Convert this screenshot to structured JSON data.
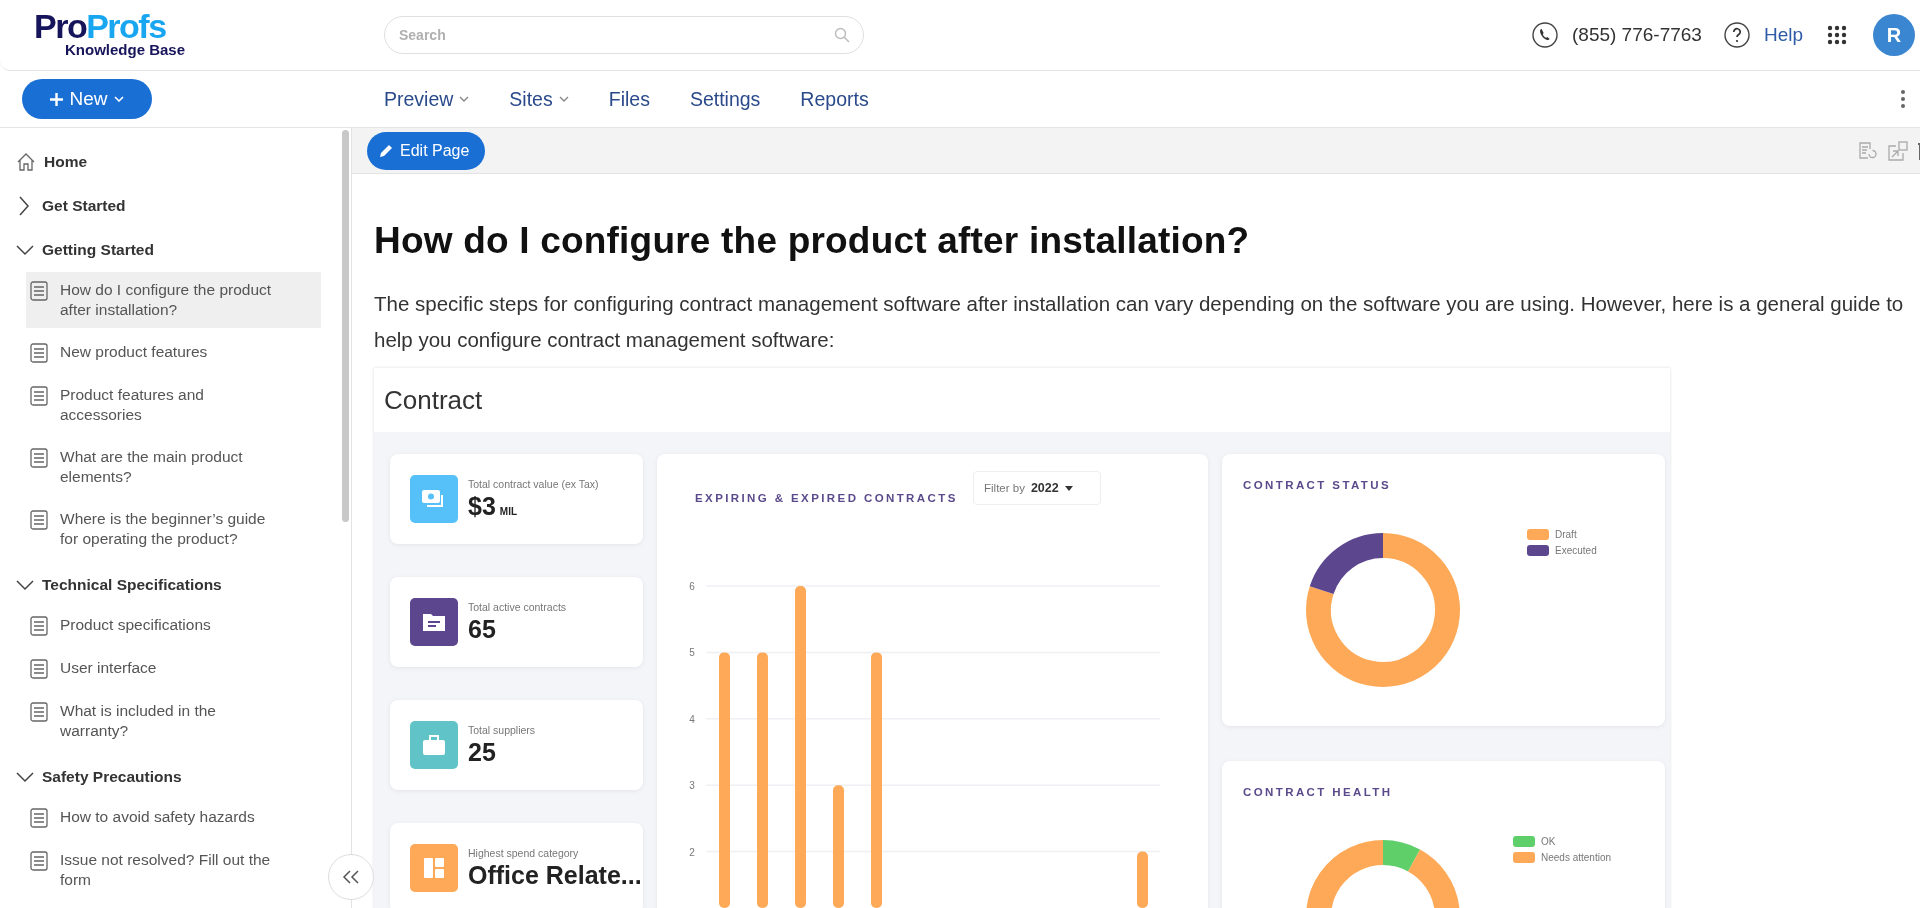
{
  "header": {
    "logo": {
      "wordmark": [
        "Pro",
        "Profs"
      ],
      "subtitle": "Knowledge Base"
    },
    "search": {
      "placeholder": "Search"
    },
    "phone": "(855) 776-7763",
    "help": "Help",
    "avatar": "R"
  },
  "navbar": {
    "new_button": "New",
    "links": [
      {
        "label": "Preview",
        "dropdown": true
      },
      {
        "label": "Sites",
        "dropdown": true
      },
      {
        "label": "Files",
        "dropdown": false
      },
      {
        "label": "Settings",
        "dropdown": false
      },
      {
        "label": "Reports",
        "dropdown": false
      }
    ]
  },
  "toolbar": {
    "edit_button": "Edit Page"
  },
  "sidebar": {
    "items": [
      {
        "label": "Home",
        "kind": "home",
        "selected": false
      },
      {
        "label": "Get Started",
        "kind": "folder",
        "expanded": false,
        "selected": false
      },
      {
        "label": "Getting Started",
        "kind": "folder",
        "expanded": true,
        "selected": false,
        "children": [
          {
            "label": "How do I configure the product after installation?",
            "selected": true
          },
          {
            "label": "New product features",
            "selected": false
          },
          {
            "label": "Product features and accessories",
            "selected": false
          },
          {
            "label": "What are the main product elements?",
            "selected": false
          },
          {
            "label": "Where is the beginner’s guide for operating the product?",
            "selected": false
          }
        ]
      },
      {
        "label": "Technical Specifications",
        "kind": "folder",
        "expanded": true,
        "selected": false,
        "children": [
          {
            "label": "Product specifications",
            "selected": false
          },
          {
            "label": "User interface",
            "selected": false
          },
          {
            "label": "What is included in the warranty?",
            "selected": false
          }
        ]
      },
      {
        "label": "Safety Precautions",
        "kind": "folder",
        "expanded": true,
        "selected": false,
        "children": [
          {
            "label": "How to avoid safety hazards",
            "selected": false
          },
          {
            "label": "Issue not resolved? Fill out the form",
            "selected": false
          }
        ]
      }
    ]
  },
  "article": {
    "title": "How do I configure the product after installation?",
    "intro": "The specific steps for configuring contract management software after installation can vary depending on the software you are using. However, here is a general guide to help you configure contract management software:",
    "dashboard": {
      "title": "Contract",
      "kpis": [
        {
          "kind": "money",
          "color": "#56c1f9",
          "label": "Total contract value (ex Tax)",
          "value": "$3",
          "unit": "MIL"
        },
        {
          "kind": "folder",
          "color": "#5c468e",
          "label": "Total active contracts",
          "value": "65"
        },
        {
          "kind": "briefcase",
          "color": "#5fc3c8",
          "label": "Total suppliers",
          "value": "25"
        },
        {
          "kind": "layout",
          "color": "#fea957",
          "label": "Highest spend category",
          "value": "Office Relate..."
        }
      ],
      "expiring": {
        "filter_label": "Filter by",
        "filter_value": "2022",
        "chart_data": {
          "type": "bar",
          "title": "EXPIRING & EXPIRED CONTRACTS",
          "values": [
            5,
            5,
            6,
            3,
            5,
            null,
            null,
            null,
            null,
            null,
            null,
            2
          ],
          "ylim": [
            1.15,
            6
          ],
          "yticks": [
            2,
            3,
            4,
            5,
            6
          ],
          "grid": true
        }
      },
      "status": {
        "title": "CONTRACT STATUS",
        "legend": [
          {
            "label": "Draft",
            "color": "#fea957"
          },
          {
            "label": "Executed",
            "color": "#5c468e"
          }
        ]
      },
      "health": {
        "title": "CONTRACT HEALTH",
        "legend": [
          {
            "label": "OK",
            "color": "#5fcf6a"
          },
          {
            "label": "Needs attention",
            "color": "#fea957"
          }
        ]
      }
    }
  }
}
